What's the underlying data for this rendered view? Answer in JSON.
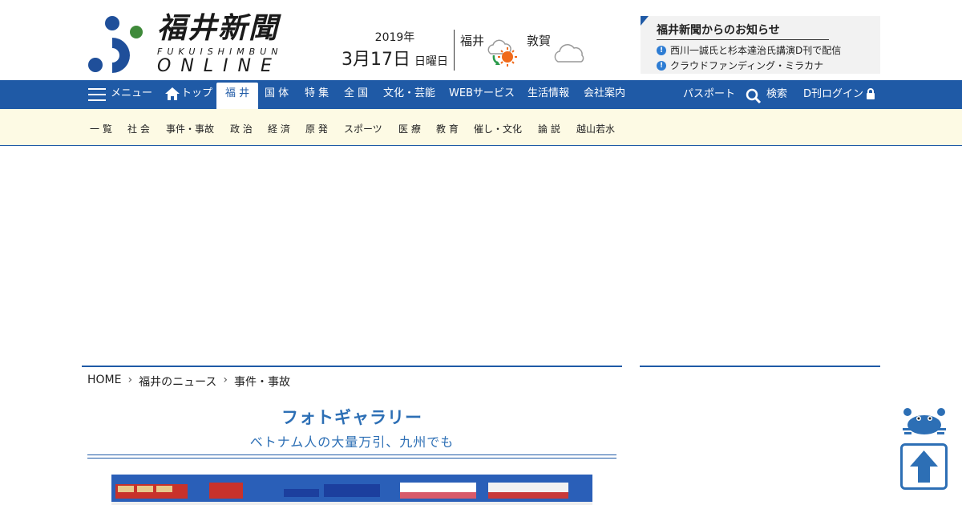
{
  "logo": {
    "jp": "福井新聞",
    "en_line1": "FUKUISHIMBUN",
    "en_line2": "ONLINE"
  },
  "date": {
    "year": "2019年",
    "month_day": "3月17日",
    "weekday": "日曜日"
  },
  "weather": [
    {
      "city": "福井",
      "icon": "cloud-then-sun-icon"
    },
    {
      "city": "敦賀",
      "icon": "cloud-icon"
    }
  ],
  "notice": {
    "title": "福井新聞からのお知らせ",
    "items": [
      "西川一誠氏と杉本達治氏講演D刊で配信",
      "クラウドファンディング・ミラカナ"
    ]
  },
  "nav": {
    "menu": "メニュー",
    "top": "トップ",
    "items": [
      "福 井",
      "国 体",
      "特 集",
      "全 国",
      "文化・芸能",
      "WEBサービス",
      "生活情報",
      "会社案内"
    ],
    "passport": "パスポート",
    "search": "検索",
    "login": "D刊ログイン"
  },
  "subnav": [
    "一 覧",
    "社 会",
    "事件・事故",
    "政 治",
    "経 済",
    "原 発",
    "スポーツ",
    "医 療",
    "教 育",
    "催し・文化",
    "論 説",
    "越山若水"
  ],
  "breadcrumb": [
    "HOME",
    "福井のニュース",
    "事件・事故"
  ],
  "gallery": {
    "title": "フォトギャラリー",
    "subtitle": "ベトナム人の大量万引、九州でも"
  },
  "colors": {
    "brand_blue": "#1f5aa6",
    "subnav_bg": "#fdfae4",
    "title_blue": "#2d6fb5"
  }
}
